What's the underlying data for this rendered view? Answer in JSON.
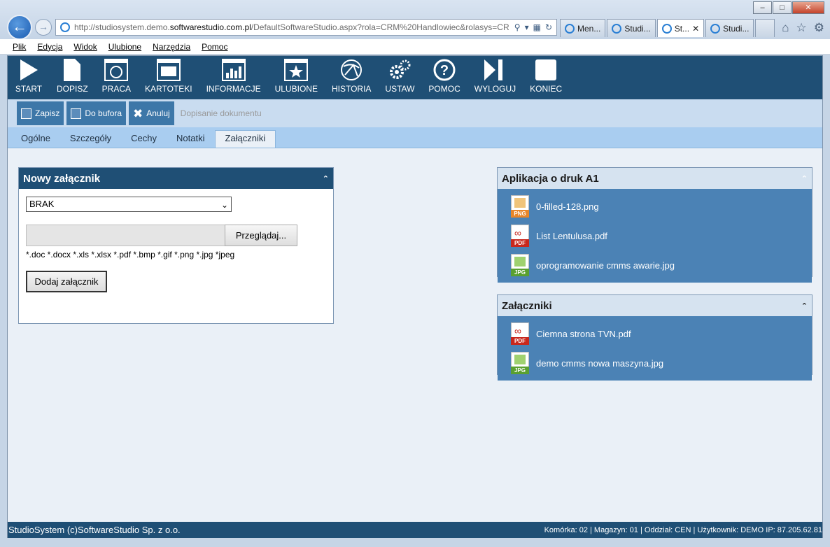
{
  "browser": {
    "url_prefix": "http://studiosystem.demo.",
    "url_domain": "softwarestudio.com.pl",
    "url_rest": "/DefaultSoftwareStudio.aspx?rola=CRM%20Handlowiec&rolasys=CR",
    "tabs": [
      {
        "label": "Men..."
      },
      {
        "label": "Studi..."
      },
      {
        "label": "St..."
      },
      {
        "label": "Studi..."
      }
    ],
    "win_min": "–",
    "win_max": "□",
    "win_close": "✕"
  },
  "menu": [
    "Plik",
    "Edycja",
    "Widok",
    "Ulubione",
    "Narzędzia",
    "Pomoc"
  ],
  "toolbar": [
    {
      "label": "START",
      "icon": "start-icon"
    },
    {
      "label": "DOPISZ",
      "icon": "document-icon"
    },
    {
      "label": "PRACA",
      "icon": "work-icon"
    },
    {
      "label": "KARTOTEKI",
      "icon": "files-icon"
    },
    {
      "label": "INFORMACJE",
      "icon": "chart-icon"
    },
    {
      "label": "ULUBIONE",
      "icon": "star-icon"
    },
    {
      "label": "HISTORIA",
      "icon": "history-icon"
    },
    {
      "label": "USTAW",
      "icon": "gear-icon"
    },
    {
      "label": "POMOC",
      "icon": "help-icon"
    },
    {
      "label": "WYLOGUJ",
      "icon": "logout-icon"
    },
    {
      "label": "KONIEC",
      "icon": "end-icon"
    }
  ],
  "actions": {
    "save": "Zapisz",
    "buffer": "Do bufora",
    "cancel": "Anuluj",
    "hint": "Dopisanie dokumentu"
  },
  "tabs": [
    "Ogólne",
    "Szczegóły",
    "Cechy",
    "Notatki",
    "Załączniki"
  ],
  "active_tab": "Załączniki",
  "new_attachment": {
    "title": "Nowy załącznik",
    "select_value": "BRAK",
    "browse": "Przeglądaj...",
    "extensions": "*.doc *.docx *.xls *.xlsx *.pdf *.bmp *.gif *.png *.jpg *jpeg",
    "add": "Dodaj załącznik"
  },
  "panel_a1": {
    "title": "Aplikacja o druk A1",
    "files": [
      {
        "name": "0-filled-128.png",
        "type": "PNG",
        "color": "#e8862a"
      },
      {
        "name": "List Lentulusa.pdf",
        "type": "PDF",
        "color": "#c8281e"
      },
      {
        "name": "oprogramowanie cmms awarie.jpg",
        "type": "JPG",
        "color": "#5aa030"
      }
    ]
  },
  "panel_att": {
    "title": "Załączniki",
    "files": [
      {
        "name": "Ciemna strona TVN.pdf",
        "type": "PDF",
        "color": "#c8281e"
      },
      {
        "name": "demo cmms nowa maszyna.jpg",
        "type": "JPG",
        "color": "#5aa030"
      }
    ]
  },
  "status": {
    "left": "StudioSystem (c)SoftwareStudio Sp. z o.o.",
    "right": "Komórka: 02 | Magazyn: 01 | Oddział: CEN | Użytkownik: DEMO IP: 87.205.62.81"
  }
}
